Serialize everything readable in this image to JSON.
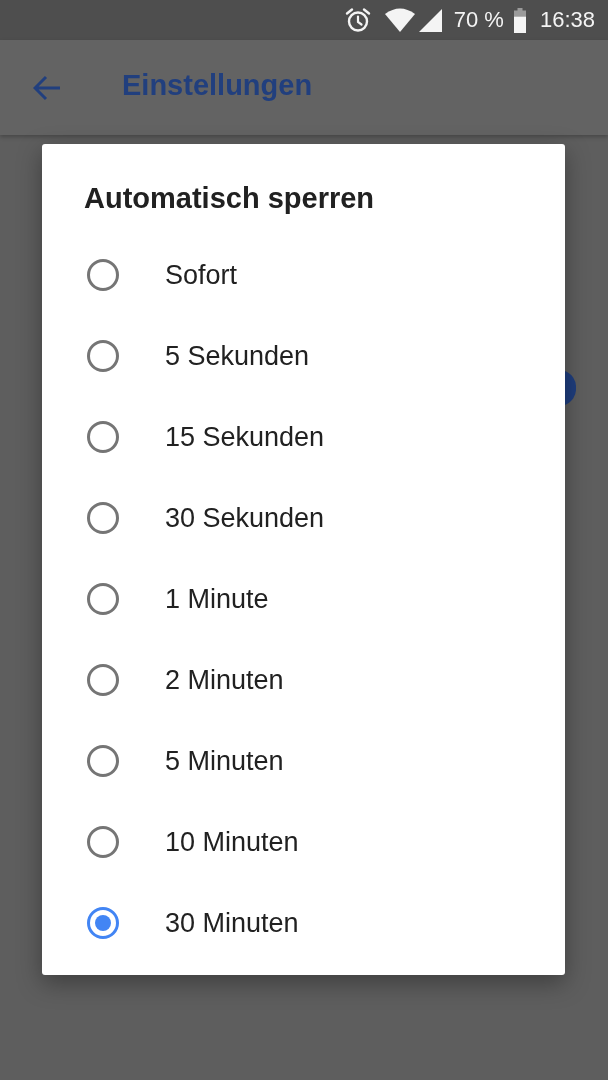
{
  "status_bar": {
    "battery_text": "70 %",
    "time": "16:38"
  },
  "app_bar": {
    "title": "Einstellungen"
  },
  "dialog": {
    "title": "Automatisch sperren",
    "options": [
      {
        "label": "Sofort",
        "selected": false
      },
      {
        "label": "5 Sekunden",
        "selected": false
      },
      {
        "label": "15 Sekunden",
        "selected": false
      },
      {
        "label": "30 Sekunden",
        "selected": false
      },
      {
        "label": "1 Minute",
        "selected": false
      },
      {
        "label": "2 Minuten",
        "selected": false
      },
      {
        "label": "5 Minuten",
        "selected": false
      },
      {
        "label": "10 Minuten",
        "selected": false
      },
      {
        "label": "30 Minuten",
        "selected": true
      }
    ]
  }
}
